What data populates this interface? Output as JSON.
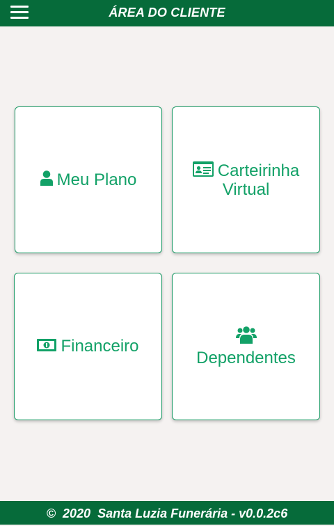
{
  "header": {
    "title": "ÁREA DO CLIENTE",
    "menu_icon": "hamburger-menu-icon"
  },
  "cards": {
    "meu_plano": {
      "label": "Meu Plano",
      "icon": "user-icon"
    },
    "carteirinha": {
      "line1": "Carteirinha",
      "line2": "Virtual",
      "icon": "id-card-icon"
    },
    "financeiro": {
      "label": "Financeiro",
      "icon": "money-bill-icon"
    },
    "dependentes": {
      "label": "Dependentes",
      "icon": "users-group-icon"
    }
  },
  "footer": {
    "text": "©  2020  Santa Luzia Funerária - v0.0.2c6"
  },
  "colors": {
    "header_bg": "#066b3a",
    "accent": "#12a167",
    "page_bg": "#f5f2f1"
  }
}
